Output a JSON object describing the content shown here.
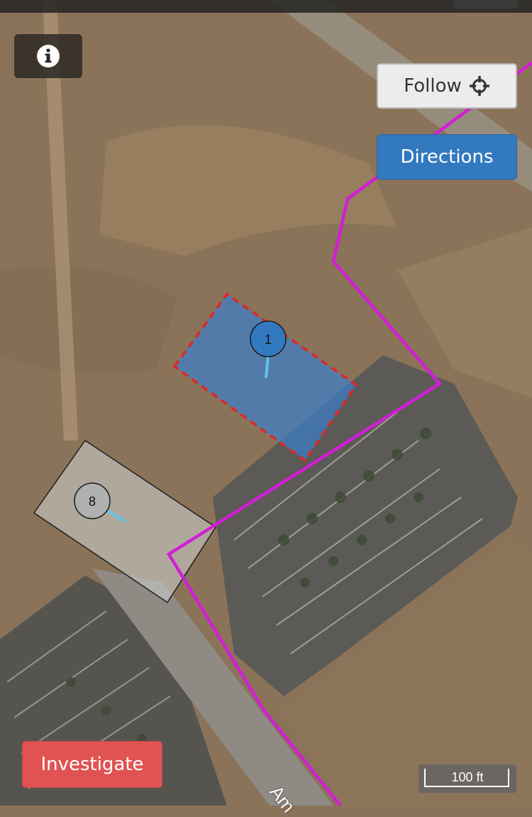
{
  "controls": {
    "info_icon": "info-icon",
    "follow_label": "Follow",
    "follow_icon": "crosshair-icon",
    "directions_label": "Directions",
    "investigate_label": "Investigate"
  },
  "map": {
    "scale_label": "100 ft",
    "road_label": "Am",
    "markers": [
      {
        "label": "1",
        "color": "#3379bf"
      },
      {
        "label": "8",
        "color": "#b0b0b0"
      }
    ],
    "colors": {
      "route": "#d21ed6",
      "selected_area_fill": "#3a7fd0",
      "selected_area_border": "#e02626",
      "secondary_area_fill": "#c8c8c8",
      "terrain": "#8a7358",
      "parking": "#5c5a56"
    }
  }
}
